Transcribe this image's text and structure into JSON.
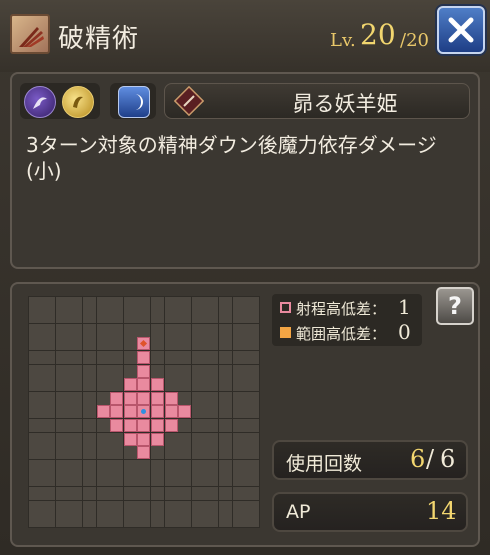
{
  "header": {
    "title": "破精術",
    "level_label": "Lv.",
    "level_value": "20",
    "level_max": "/20"
  },
  "info": {
    "unit_name": "昴る妖羊姫",
    "description": "3ターン対象の精神ダウン後魔力依存ダメージ(小)"
  },
  "range": {
    "height_diff_label": "射程高低差：",
    "height_diff_value": "1",
    "area_diff_label": "範囲高低差：",
    "area_diff_value": "0",
    "range_color": "#e98a9f",
    "area_color": "#f3a544"
  },
  "stats": {
    "uses_label": "使用回数",
    "uses_current": "6",
    "uses_sep": "/",
    "uses_max": "6",
    "ap_label": "AP",
    "ap_value": "14"
  },
  "icons": [
    "skill-claw-icon",
    "close-icon",
    "dark-element-icon",
    "gold-orb-icon",
    "moon-icon",
    "unit-emblem-icon",
    "help-icon"
  ]
}
